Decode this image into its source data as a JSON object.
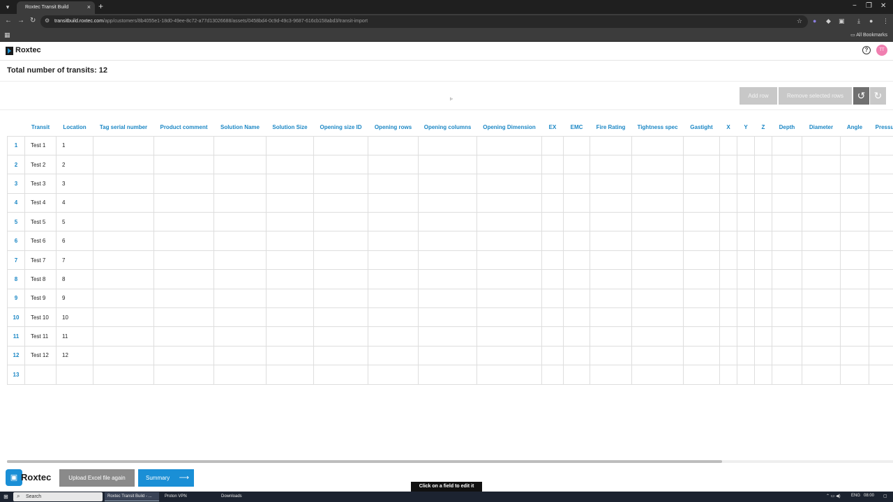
{
  "browser": {
    "tab_title": "Roxtec Transit Build",
    "tab_close": "×",
    "new_tab": "+",
    "minimize": "−",
    "restore": "❐",
    "close": "✕",
    "url_host": "transitbuild.roxtec.com",
    "url_path": "/app/customers/8b4055e1-18d0-49ee-8c72-a77d13026688/assets/0458bd4-0c9d-49c3-9687-616cb158abd3/transit-import",
    "all_bookmarks": "All Bookmarks"
  },
  "app": {
    "logo_text": "Roxtec",
    "avatar_initials": "TT",
    "help": "?"
  },
  "page": {
    "title": "Total number of transits: 12"
  },
  "actions": {
    "add_row": "Add row",
    "remove_selected_rows": "Remove selected rows",
    "undo": "↺",
    "redo": "↻"
  },
  "grid": {
    "columns": [
      "",
      "Transit",
      "Location",
      "Tag serial number",
      "Product comment",
      "Solution Name",
      "Solution Size",
      "Opening size ID",
      "Opening rows",
      "Opening columns",
      "Opening Dimension",
      "EX",
      "EMC",
      "Fire Rating",
      "Tightness spec",
      "Gastight",
      "X",
      "Y",
      "Z",
      "Depth",
      "Diameter",
      "Angle",
      "Pressu"
    ],
    "rows": [
      {
        "num": "1",
        "transit": "Test 1",
        "location": "1"
      },
      {
        "num": "2",
        "transit": "Test 2",
        "location": "2"
      },
      {
        "num": "3",
        "transit": "Test 3",
        "location": "3"
      },
      {
        "num": "4",
        "transit": "Test 4",
        "location": "4"
      },
      {
        "num": "5",
        "transit": "Test 5",
        "location": "5"
      },
      {
        "num": "6",
        "transit": "Test 6",
        "location": "6"
      },
      {
        "num": "7",
        "transit": "Test 7",
        "location": "7"
      },
      {
        "num": "8",
        "transit": "Test 8",
        "location": "8"
      },
      {
        "num": "9",
        "transit": "Test 9",
        "location": "9"
      },
      {
        "num": "10",
        "transit": "Test 10",
        "location": "10"
      },
      {
        "num": "11",
        "transit": "Test 11",
        "location": "11"
      },
      {
        "num": "12",
        "transit": "Test 12",
        "location": "12"
      },
      {
        "num": "13",
        "transit": "",
        "location": ""
      }
    ]
  },
  "footer": {
    "logo_text": "Roxtec",
    "upload_again": "Upload Excel file again",
    "summary": "Summary",
    "summary_arrow": "⟶",
    "toast": "Click on a field to edit it"
  },
  "taskbar": {
    "search": "Search",
    "apps": [
      "Roxtec Transit Build - ...",
      "Proton VPN",
      "Downloads"
    ],
    "lang": "ENG",
    "time": "08:00"
  },
  "colors": {
    "accent": "#1a8fd6",
    "header_text": "#1b87c5"
  }
}
